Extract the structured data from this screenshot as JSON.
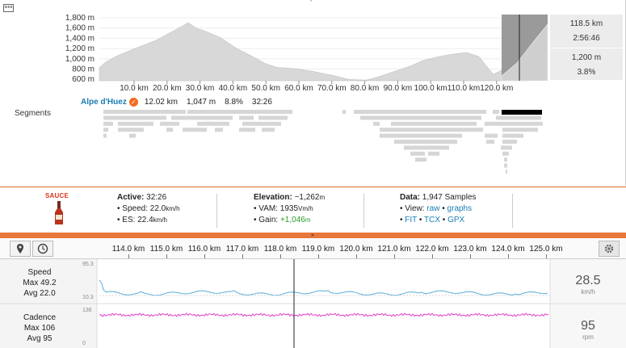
{
  "elevation": {
    "y_ticks": [
      "1,800 m",
      "1,600 m",
      "1,400 m",
      "1,200 m",
      "1,000 m",
      "800 m",
      "600 m"
    ],
    "x_ticks": [
      "10.0 km",
      "20.0 km",
      "30.0 km",
      "40.0 km",
      "50.0 km",
      "60.0 km",
      "70.0 km",
      "80.0 km",
      "90.0 km",
      "100.0 km",
      "110.0 km",
      "120.0 km"
    ],
    "stats": [
      "118.5 km",
      "2:56:46",
      "1,200 m",
      "3.8%"
    ]
  },
  "segment": {
    "name": "Alpe d'Huez",
    "badge": "✓",
    "distance": "12.02 km",
    "elevation": "1,047 m",
    "grade": "8.8%",
    "time": "32:26"
  },
  "segments_label": "Segments",
  "info": {
    "logo": "SAUCE",
    "active": {
      "title": "Active:",
      "value": "32:26",
      "speed_label": "Speed:",
      "speed": "22.0",
      "speed_unit": "km/h",
      "es_label": "ES:",
      "es": "22.4",
      "es_unit": "km/h"
    },
    "elevation": {
      "title": "Elevation:",
      "value": "~1,262",
      "unit": "m",
      "vam_label": "VAM:",
      "vam": "1935",
      "vam_unit": "Vm/h",
      "gain_label": "Gain:",
      "gain": "+1,046",
      "gain_unit": "m"
    },
    "data": {
      "title": "Data:",
      "samples": "1,947 Samples",
      "view_label": "View:",
      "raw": "raw",
      "graphs": "graphs",
      "fit": "FIT",
      "tcx": "TCX",
      "gpx": "GPX",
      "dot": "•"
    }
  },
  "colors": {
    "accent": "#e8773c",
    "link": "#1a7cb5",
    "speed_line": "#5aaedb",
    "cadence_line": "#e040c8",
    "gain": "#2a9a2a"
  },
  "toolbar": {
    "icons": [
      "pin-icon",
      "clock-icon",
      "gear-icon"
    ],
    "axis": [
      "114.0 km",
      "115.0 km",
      "116.0 km",
      "117.0 km",
      "118.0 km",
      "119.0 km",
      "120.0 km",
      "121.0 km",
      "122.0 km",
      "123.0 km",
      "124.0 km",
      "125.0 km"
    ]
  },
  "streams": {
    "speed": {
      "label": "Speed",
      "max": "Max 49.2",
      "avg": "Avg 22.0",
      "axis_top": "95.3",
      "axis_bottom": "10.3",
      "value": "28.5",
      "unit": "km/h"
    },
    "cadence": {
      "label": "Cadence",
      "max": "Max 106",
      "avg": "Avg 95",
      "axis_top": "136",
      "axis_bottom": "0",
      "value": "95",
      "unit": "rpm"
    }
  }
}
